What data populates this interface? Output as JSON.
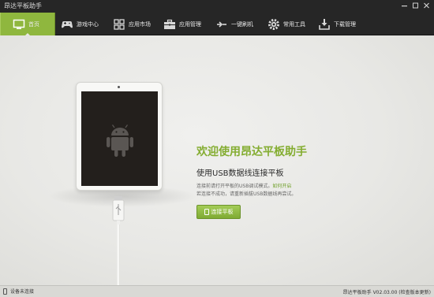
{
  "window": {
    "title": "昂达平板助手",
    "controls": [
      "minimize-icon",
      "maximize-icon",
      "close-icon"
    ]
  },
  "nav": {
    "items": [
      {
        "label": "首页",
        "icon": "monitor-icon",
        "active": true
      },
      {
        "label": "游戏中心",
        "icon": "gamepad-icon",
        "active": false
      },
      {
        "label": "应用市场",
        "icon": "grid-icon",
        "active": false
      },
      {
        "label": "应用管理",
        "icon": "toolbox-icon",
        "active": false
      },
      {
        "label": "一键刷机",
        "icon": "refresh-icon",
        "active": false
      },
      {
        "label": "常用工具",
        "icon": "gear-icon",
        "active": false
      },
      {
        "label": "下载管理",
        "icon": "download-icon",
        "active": false
      }
    ],
    "accent": "#8fb73e"
  },
  "main": {
    "welcome_title": "欢迎使用昂达平板助手",
    "sub_title": "使用USB数据线连接平板",
    "hint_line1": "连接前请打开平板的USB调试模式。",
    "hint_link": "如何开启",
    "hint_line2": "若连接不成功，请重新插拔USB数据线再尝试。",
    "connect_button": "连接平板",
    "device_image": "tablet-with-android-logo-and-usb-cable"
  },
  "status": {
    "device_status": "设备未连接",
    "version_info": "昂达平板助手 V02.03.00 (检查版本更新)"
  },
  "colors": {
    "dark_chrome": "#262626",
    "accent_green": "#8fb73e",
    "title_green": "#84ad31",
    "background": "#e9e9e6"
  }
}
